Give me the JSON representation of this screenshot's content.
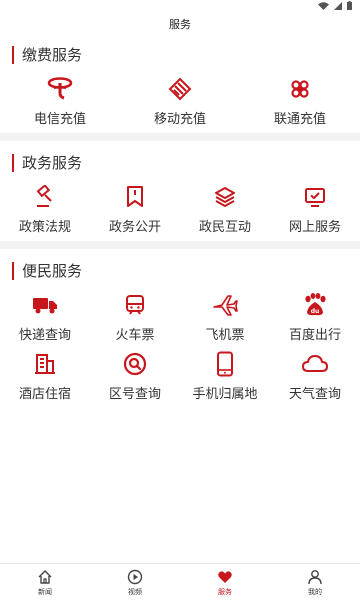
{
  "header": {
    "title": "服务"
  },
  "colors": {
    "accent": "#c8161d",
    "divider": "#f2f2f2"
  },
  "sections": [
    {
      "title": "缴费服务",
      "rows": [
        [
          {
            "label": "电信充值",
            "icon": "telecom-icon"
          },
          {
            "label": "移动充值",
            "icon": "mobile-icon"
          },
          {
            "label": "联通充值",
            "icon": "unicom-icon"
          }
        ]
      ]
    },
    {
      "title": "政务服务",
      "rows": [
        [
          {
            "label": "政策法规",
            "icon": "gavel-icon"
          },
          {
            "label": "政务公开",
            "icon": "bookmark-icon"
          },
          {
            "label": "政民互动",
            "icon": "layers-icon"
          },
          {
            "label": "网上服务",
            "icon": "monitor-icon"
          }
        ]
      ]
    },
    {
      "title": "便民服务",
      "rows": [
        [
          {
            "label": "快递查询",
            "icon": "truck-icon"
          },
          {
            "label": "火车票",
            "icon": "train-icon"
          },
          {
            "label": "飞机票",
            "icon": "airplane-icon"
          },
          {
            "label": "百度出行",
            "icon": "baidu-icon"
          }
        ],
        [
          {
            "label": "酒店住宿",
            "icon": "hotel-icon"
          },
          {
            "label": "区号查询",
            "icon": "search-circle-icon"
          },
          {
            "label": "手机归属地",
            "icon": "phone-icon"
          },
          {
            "label": "天气查询",
            "icon": "cloud-icon"
          }
        ]
      ]
    }
  ],
  "tabbar": {
    "items": [
      {
        "label": "新闻",
        "icon": "home-icon",
        "active": false
      },
      {
        "label": "视频",
        "icon": "play-icon",
        "active": false
      },
      {
        "label": "服务",
        "icon": "heart-icon",
        "active": true
      },
      {
        "label": "我的",
        "icon": "user-icon",
        "active": false
      }
    ]
  }
}
